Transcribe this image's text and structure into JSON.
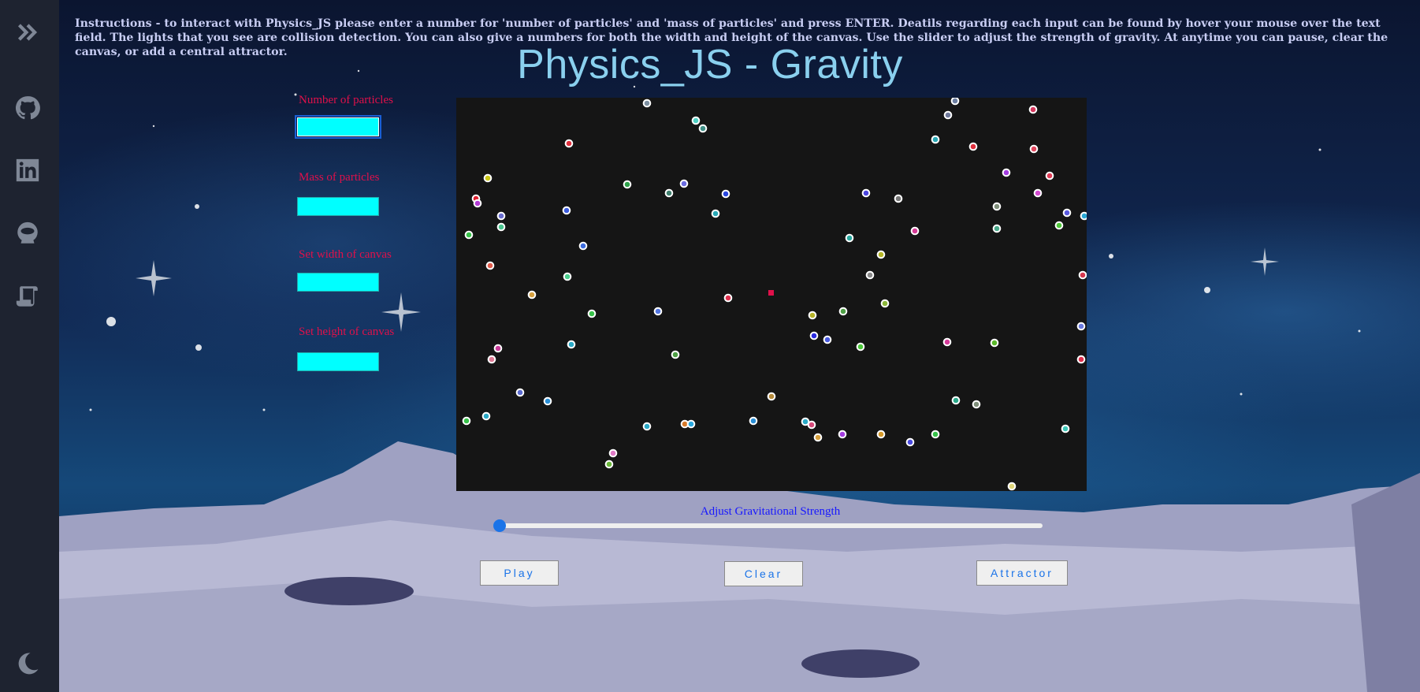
{
  "sidebar": {
    "items": [
      {
        "icon": "chevrons-right-icon"
      },
      {
        "icon": "github-icon"
      },
      {
        "icon": "linkedin-icon"
      },
      {
        "icon": "space-helmet-icon"
      },
      {
        "icon": "scroll-icon"
      }
    ],
    "footer_icon": "moon-icon"
  },
  "instructions": "Instructions - to interact with Physics_JS please enter a number for 'number of particles' and 'mass of particles' and press ENTER. Deatils regarding each input can be found by hover your mouse over the text field. The lights that you see are collision detection. You can also give a numbers for both the width and height of the canvas. Use the slider to adjust the strength of gravity. At anytime you can pause, clear the canvas, or add a central attractor.",
  "title": "Physics_JS - Gravity",
  "inputs": {
    "particles_label": "Number of particles",
    "particles_value": "",
    "mass_label": "Mass of particles",
    "mass_value": "",
    "width_label": "Set width of canvas",
    "width_value": "",
    "height_label": "Set height of canvas",
    "height_value": ""
  },
  "slider": {
    "label": "Adjust Gravitational Strength",
    "value_fraction": 0.0
  },
  "buttons": {
    "play": "Play",
    "clear": "Clear",
    "attractor": "Attractor"
  },
  "colors": {
    "sidebar_bg": "#1e2330",
    "canvas_bg": "#151515",
    "input_bg": "#00ffff",
    "label_red": "#e0104a",
    "slider_label_blue": "#1717ff",
    "accent_blue": "#1a73e8",
    "title_color": "#8ad0ee"
  }
}
